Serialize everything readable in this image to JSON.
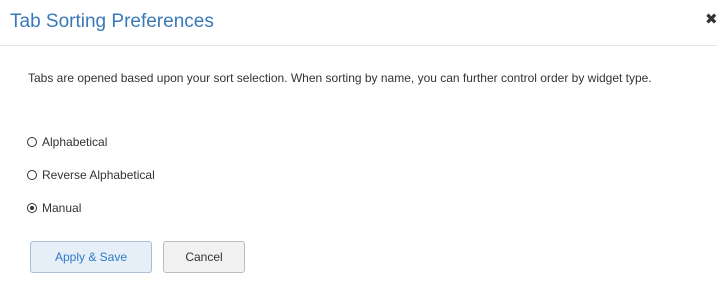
{
  "dialog": {
    "title": "Tab Sorting Preferences",
    "close_glyph": "✖",
    "close_icon": "close-icon",
    "description": "Tabs are opened based upon your sort selection. When sorting by name, you can further control order by widget type.",
    "options": [
      {
        "label": "Alphabetical",
        "checked": false
      },
      {
        "label": "Reverse Alphabetical",
        "checked": false
      },
      {
        "label": "Manual",
        "checked": true
      }
    ],
    "buttons": {
      "apply_label": "Apply & Save",
      "cancel_label": "Cancel"
    },
    "colors": {
      "title": "#3a79b8",
      "primary_text": "#2f7bc8",
      "primary_bg": "#e6eef8",
      "text": "#333333"
    }
  }
}
